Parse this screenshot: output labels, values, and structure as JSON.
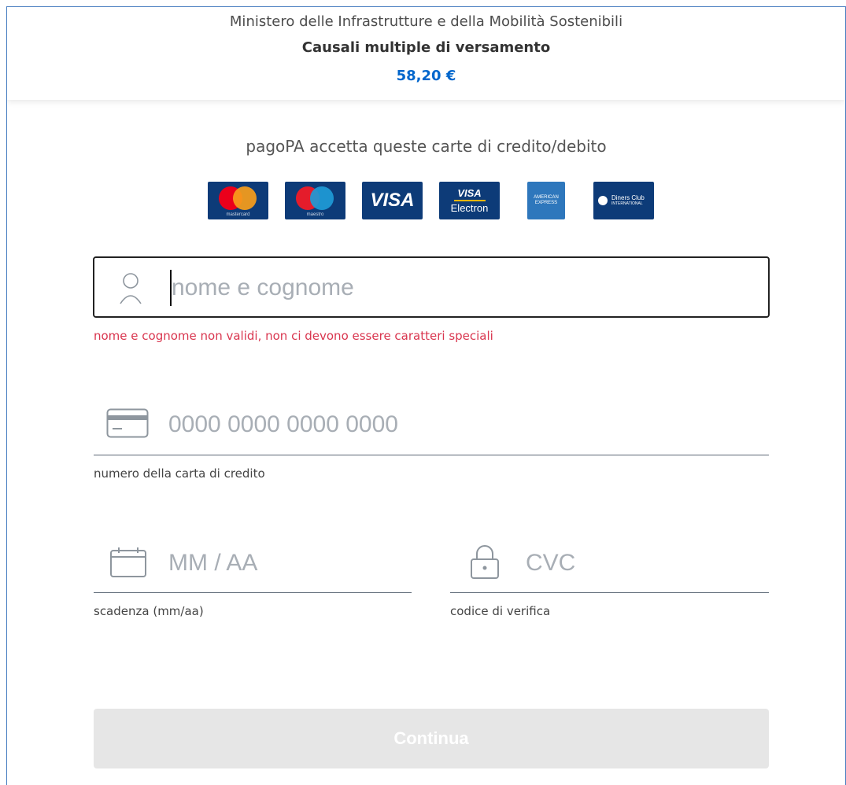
{
  "header": {
    "organization": "Ministero delle Infrastrutture e della Mobilità Sostenibili",
    "payment_reason": "Causali multiple di versamento",
    "amount": "58,20 €"
  },
  "cards": {
    "intro": "pagoPA accetta queste carte di credito/debito",
    "logos": [
      {
        "name": "mastercard",
        "caption": "mastercard"
      },
      {
        "name": "maestro",
        "caption": "maestro"
      },
      {
        "name": "visa",
        "text": "VISA"
      },
      {
        "name": "visa-electron",
        "text": "VISA",
        "caption": "Electron"
      },
      {
        "name": "american-express",
        "text": "AMERICAN EXPRESS"
      },
      {
        "name": "diners-club",
        "text": "Diners Club",
        "caption": "INTERNATIONAL"
      }
    ]
  },
  "form": {
    "name": {
      "placeholder": "nome e cognome",
      "error": "nome e cognome non validi, non ci devono essere caratteri speciali",
      "icon": "user-icon"
    },
    "card_number": {
      "placeholder": "0000 0000 0000 0000",
      "help": "numero della carta di credito",
      "icon": "credit-card-icon"
    },
    "expiry": {
      "placeholder": "MM / AA",
      "help": "scadenza (mm/aa)",
      "icon": "calendar-icon"
    },
    "cvc": {
      "placeholder": "CVC",
      "help": "codice di verifica",
      "icon": "lock-icon"
    },
    "continue_label": "Continua"
  },
  "colors": {
    "accent": "#0066cc",
    "error": "#d9364f",
    "card_blue": "#0d3b78",
    "button_disabled": "#e6e6e6"
  }
}
